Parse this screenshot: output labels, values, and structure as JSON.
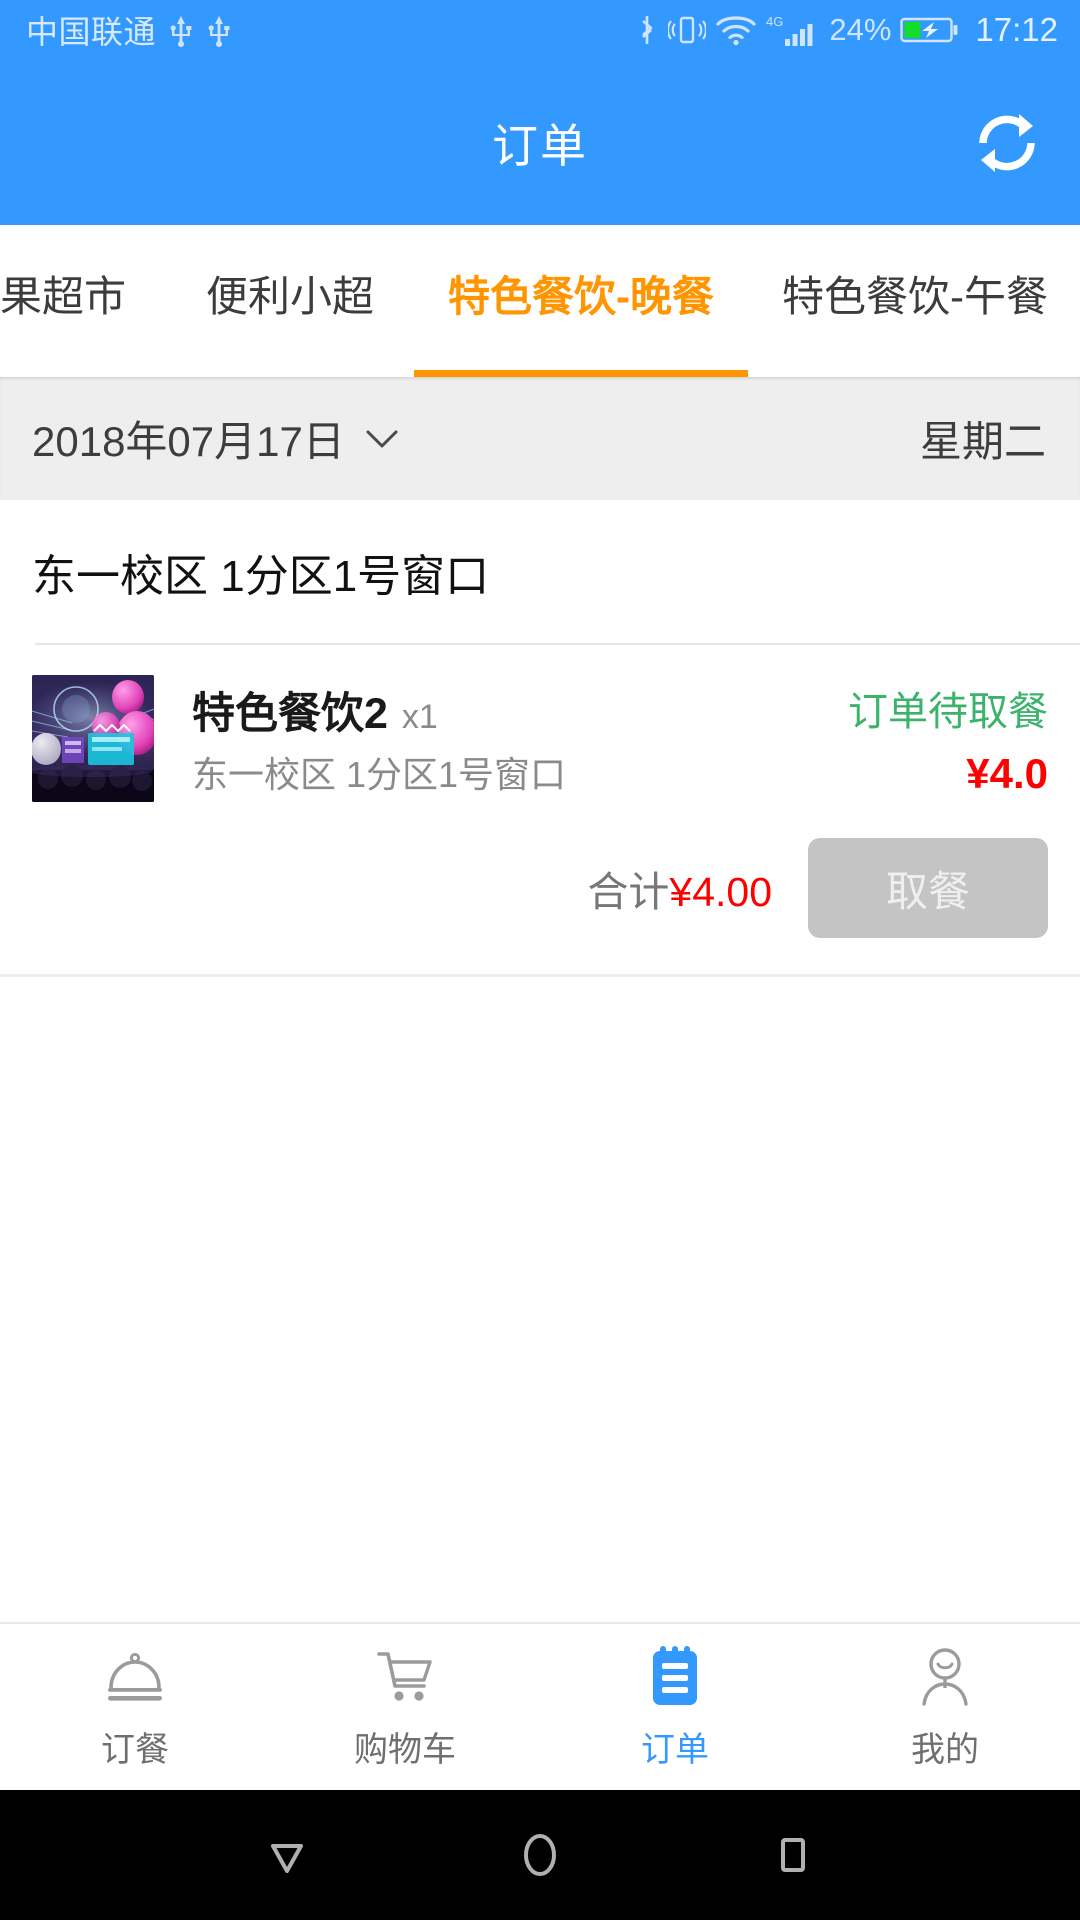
{
  "status_bar": {
    "carrier": "中国联通",
    "icons": [
      "usb-icon",
      "usb-icon",
      "bluetooth-icon",
      "vibrate-icon",
      "wifi-icon",
      "signal-4g-icon",
      "battery-charging-icon"
    ],
    "battery_percent": "24%",
    "network_type": "4G",
    "clock": "17:12"
  },
  "app_bar": {
    "title": "订单",
    "refresh_icon": "refresh-icon",
    "background_color": "#3399ff"
  },
  "tabs": {
    "accent_color": "#ff9500",
    "items": [
      {
        "label": "果超市",
        "active": false
      },
      {
        "label": "便利小超",
        "active": false
      },
      {
        "label": "特色餐饮-晚餐",
        "active": true
      },
      {
        "label": "特色餐饮-午餐",
        "active": false
      }
    ]
  },
  "date_bar": {
    "date": "2018年07月17日",
    "chevron_icon": "chevron-down-icon",
    "weekday": "星期二"
  },
  "order": {
    "shop_name": "东一校区  1分区1号窗口",
    "item": {
      "thumbnail": "concert-balloons-image",
      "name": "特色餐饮2",
      "quantity": "x1",
      "location": "东一校区 1分区1号窗口",
      "status": "订单待取餐",
      "status_color": "#3bb36b",
      "price": "¥4.0",
      "price_color": "#ff0000"
    },
    "total_label": "合计",
    "total_amount": "¥4.00",
    "action_button": "取餐",
    "action_enabled": false
  },
  "bottom_nav": {
    "active_color": "#3399ff",
    "items": [
      {
        "label": "订餐",
        "icon": "food-cloche-icon",
        "active": false
      },
      {
        "label": "购物车",
        "icon": "shopping-cart-icon",
        "active": false
      },
      {
        "label": "订单",
        "icon": "clipboard-icon",
        "active": true
      },
      {
        "label": "我的",
        "icon": "person-icon",
        "active": false
      }
    ]
  },
  "android_nav": {
    "items": [
      {
        "icon": "back-triangle-icon",
        "name": "back"
      },
      {
        "icon": "home-circle-icon",
        "name": "home"
      },
      {
        "icon": "recents-square-icon",
        "name": "recents"
      }
    ]
  }
}
